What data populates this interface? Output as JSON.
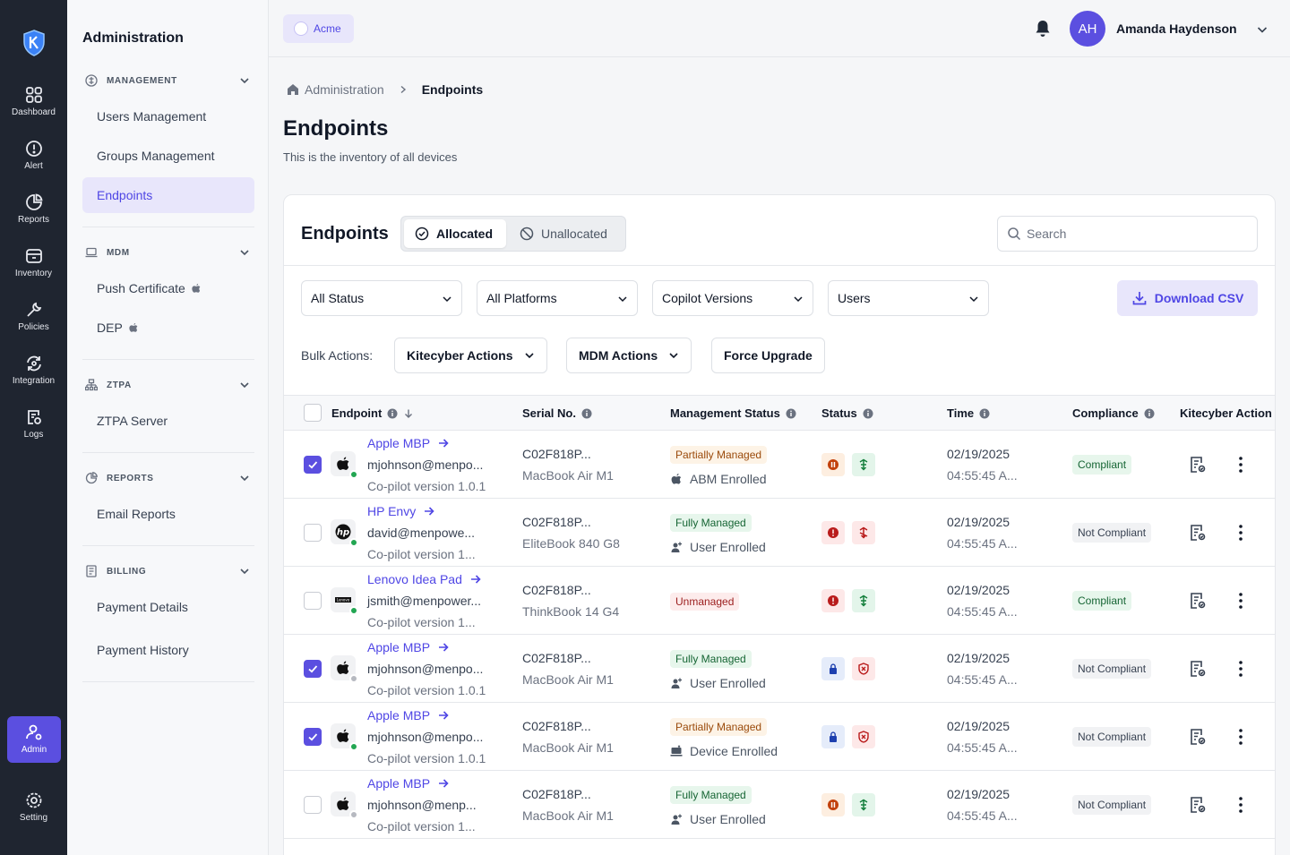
{
  "rail": {
    "items": [
      {
        "label": "Dashboard",
        "icon": "dashboard-icon"
      },
      {
        "label": "Alert",
        "icon": "alert-icon"
      },
      {
        "label": "Reports",
        "icon": "reports-icon"
      },
      {
        "label": "Inventory",
        "icon": "inventory-icon"
      },
      {
        "label": "Policies",
        "icon": "policies-icon"
      },
      {
        "label": "Integration",
        "icon": "integration-icon"
      },
      {
        "label": "Logs",
        "icon": "logs-icon"
      }
    ],
    "admin_label": "Admin",
    "setting_label": "Setting"
  },
  "sidebar": {
    "title": "Administration",
    "sections": [
      {
        "title": "MANAGEMENT",
        "items": [
          "Users Management",
          "Groups Management",
          "Endpoints"
        ]
      },
      {
        "title": "MDM",
        "items": [
          "Push Certificate",
          "DEP"
        ]
      },
      {
        "title": "ZTPA",
        "items": [
          "ZTPA Server"
        ]
      },
      {
        "title": "REPORTS",
        "items": [
          "Email Reports"
        ]
      },
      {
        "title": "BILLING",
        "items": [
          "Payment Details",
          "Payment History"
        ]
      }
    ],
    "active_item": "Endpoints"
  },
  "header": {
    "org_name": "Acme",
    "user_initials": "AH",
    "user_name": "Amanda Haydenson"
  },
  "breadcrumb": {
    "parent": "Administration",
    "current": "Endpoints"
  },
  "page": {
    "title": "Endpoints",
    "subtitle": "This is the inventory of all devices"
  },
  "card": {
    "title": "Endpoints",
    "tabs": {
      "allocated": "Allocated",
      "unallocated": "Unallocated",
      "active": "Allocated"
    },
    "search_placeholder": "Search",
    "filters": [
      "All Status",
      "All Platforms",
      "Copilot Versions",
      "Users"
    ],
    "download_label": "Download CSV",
    "bulk_label": "Bulk Actions:",
    "bulk_buttons": {
      "kitecyber": "Kitecyber Actions",
      "mdm": "MDM Actions",
      "force": "Force Upgrade"
    }
  },
  "table": {
    "columns": {
      "endpoint": "Endpoint",
      "serial": "Serial No.",
      "management": "Management Status",
      "status": "Status",
      "time": "Time",
      "compliance": "Compliance",
      "action": "Kitecyber Action"
    },
    "rows": [
      {
        "checked": true,
        "os": "apple",
        "online": true,
        "name": "Apple MBP",
        "user": "mjohnson@menpo...",
        "version": "Co-pilot version 1.0.1",
        "serial": "C02F818P...",
        "model": "MacBook Air M1",
        "mgmt": "Partially Managed",
        "mgmt_kind": "partial",
        "enroll": "ABM Enrolled",
        "enroll_icon": "apple",
        "s1": "pause-orange",
        "s2": "agent-green",
        "date": "02/19/2025",
        "time": "04:55:45 A...",
        "compliance": "Compliant"
      },
      {
        "checked": false,
        "os": "hp",
        "online": true,
        "name": "HP Envy",
        "user": "david@menpowe...",
        "version": "Co-pilot version 1...",
        "serial": "C02F818P...",
        "model": "EliteBook 840 G8",
        "mgmt": "Fully Managed",
        "mgmt_kind": "full",
        "enroll": "User Enrolled",
        "enroll_icon": "user",
        "s1": "alert-red",
        "s2": "agent-red",
        "date": "02/19/2025",
        "time": "04:55:45 A...",
        "compliance": "Not Compliant"
      },
      {
        "checked": false,
        "os": "lenovo",
        "online": true,
        "name": "Lenovo Idea Pad",
        "user": "jsmith@menpower...",
        "version": "Co-pilot version 1...",
        "serial": "C02F818P...",
        "model": "ThinkBook 14 G4",
        "mgmt": "Unmanaged",
        "mgmt_kind": "un",
        "enroll": "",
        "enroll_icon": "",
        "s1": "alert-red",
        "s2": "agent-green",
        "date": "02/19/2025",
        "time": "04:55:45 A...",
        "compliance": "Compliant"
      },
      {
        "checked": true,
        "os": "apple",
        "online": false,
        "name": "Apple MBP",
        "user": "mjohnson@menpo...",
        "version": "Co-pilot version 1.0.1",
        "serial": "C02F818P...",
        "model": "MacBook Air M1",
        "mgmt": "Fully Managed",
        "mgmt_kind": "full",
        "enroll": "User Enrolled",
        "enroll_icon": "user",
        "s1": "lock-blue",
        "s2": "shield-red",
        "date": "02/19/2025",
        "time": "04:55:45 A...",
        "compliance": "Not Compliant"
      },
      {
        "checked": true,
        "os": "apple",
        "online": true,
        "name": "Apple MBP",
        "user": "mjohnson@menpo...",
        "version": "Co-pilot version 1.0.1",
        "serial": "C02F818P...",
        "model": "MacBook Air M1",
        "mgmt": "Partially Managed",
        "mgmt_kind": "partial",
        "enroll": "Device Enrolled",
        "enroll_icon": "device",
        "s1": "lock-blue",
        "s2": "shield-red",
        "date": "02/19/2025",
        "time": "04:55:45 A...",
        "compliance": "Not Compliant"
      },
      {
        "checked": false,
        "os": "apple",
        "online": false,
        "name": "Apple MBP",
        "user": "mjohnson@menp...",
        "version": "Co-pilot version 1...",
        "serial": "C02F818P...",
        "model": "MacBook Air M1",
        "mgmt": "Fully Managed",
        "mgmt_kind": "full",
        "enroll": "User Enrolled",
        "enroll_icon": "user",
        "s1": "pause-orange",
        "s2": "agent-green",
        "date": "02/19/2025",
        "time": "04:55:45 A...",
        "compliance": "Not Compliant"
      }
    ]
  },
  "colors": {
    "accent": "#5b4fe0",
    "rail_bg": "#1f2530",
    "online": "#22a652",
    "offline": "#b6b9c0"
  }
}
